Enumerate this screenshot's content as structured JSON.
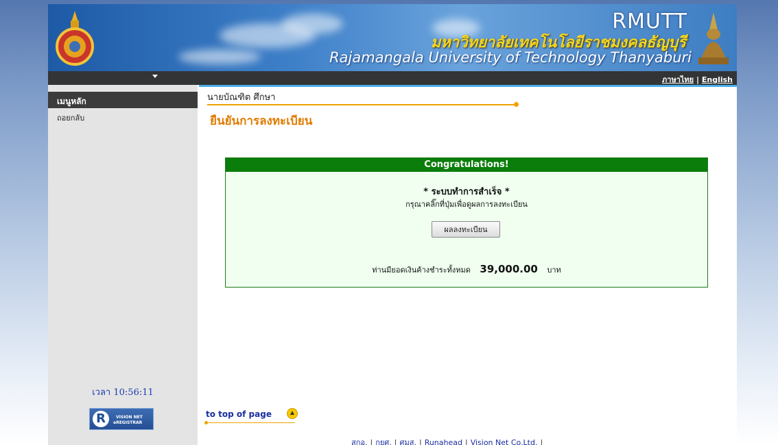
{
  "banner": {
    "acronym": "RMUTT",
    "thai_name": "มหาวิทยาลัยเทคโนโลยีราชมงคลธัญบุรี",
    "english_name": "Rajamangala University of Technology Thanyaburi"
  },
  "topbar": {
    "lang_thai": "ภาษาไทย",
    "lang_separator": "|",
    "lang_english": "English"
  },
  "sidebar": {
    "menu_header": "เมนูหลัก",
    "items": [
      {
        "label": "ถอยกลับ"
      }
    ],
    "clock_label": "เวลา",
    "clock_time": "10:56:11",
    "logo_line1": "VISION NET",
    "logo_line2": "eREGISTRAR"
  },
  "main": {
    "student_name": "นายบัณฑิต ศึกษา",
    "page_title": "ยืนยันการลงทะเบียน",
    "message": {
      "header": "Congratulations!",
      "success": "* ระบบทำการสำเร็จ *",
      "instruction": "กรุณาคลิ๊กที่ปุ่มเพื่อดูผลการลงทะเบียน",
      "button_label": "ผลลงทะเบียน",
      "balance_prefix": "ท่านมียอดเงินค้างชำระทั้งหมด",
      "balance_amount": "39,000.00",
      "balance_unit": "บาท"
    },
    "to_top_label": "to top of page"
  },
  "footer": {
    "links": [
      "สกอ.",
      "กยศ.",
      "ศมส.",
      "Runahead",
      "Vision Net Co.Ltd."
    ],
    "trailing": "|"
  },
  "colors": {
    "accent_orange": "#e07b00",
    "success_green": "#0b7d0b",
    "link_blue": "#1a2ea0"
  }
}
